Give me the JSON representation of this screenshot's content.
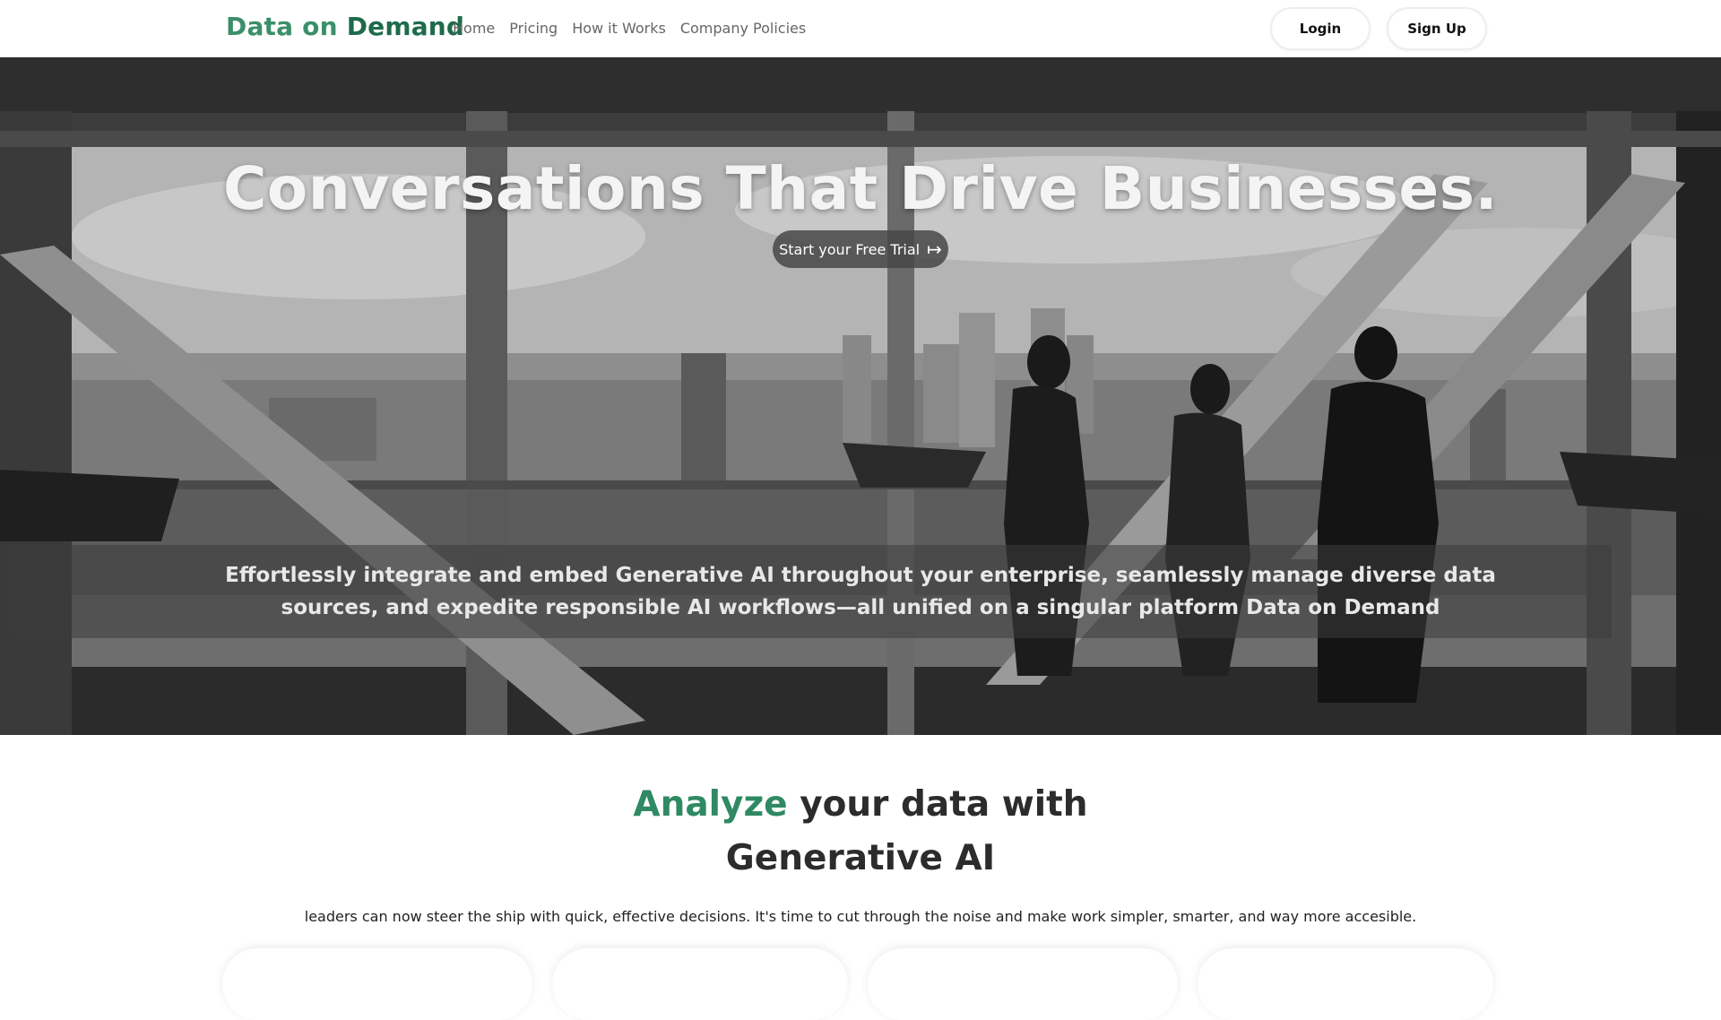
{
  "header": {
    "brand_part1": "Data on",
    "brand_part2": "Demand",
    "nav": [
      "Home",
      "Pricing",
      "How it Works",
      "Company Policies"
    ],
    "login_label": "Login",
    "signup_label": "Sign Up"
  },
  "hero": {
    "title": "Conversations That Drive Businesses.",
    "cta_label": "Start your Free Trial",
    "cta_icon": "arrow-right-bar-icon",
    "tagline": "Effortlessly integrate and embed Generative AI throughout your enterprise, seamlessly manage diverse data sources, and expedite responsible AI workflows—all unified on a singular platform Data on Demand"
  },
  "analyze": {
    "highlight": "Analyze",
    "rest_line1": "your data with",
    "line2": "Generative AI",
    "description": "leaders can now steer the ship with quick, effective decisions. It's time to cut through the noise and make work simpler, smarter, and way more accesible."
  },
  "colors": {
    "brand_green": "#3b8f6b",
    "brand_dark_green": "#1e6b4c",
    "highlight_green": "#2f8a63"
  }
}
